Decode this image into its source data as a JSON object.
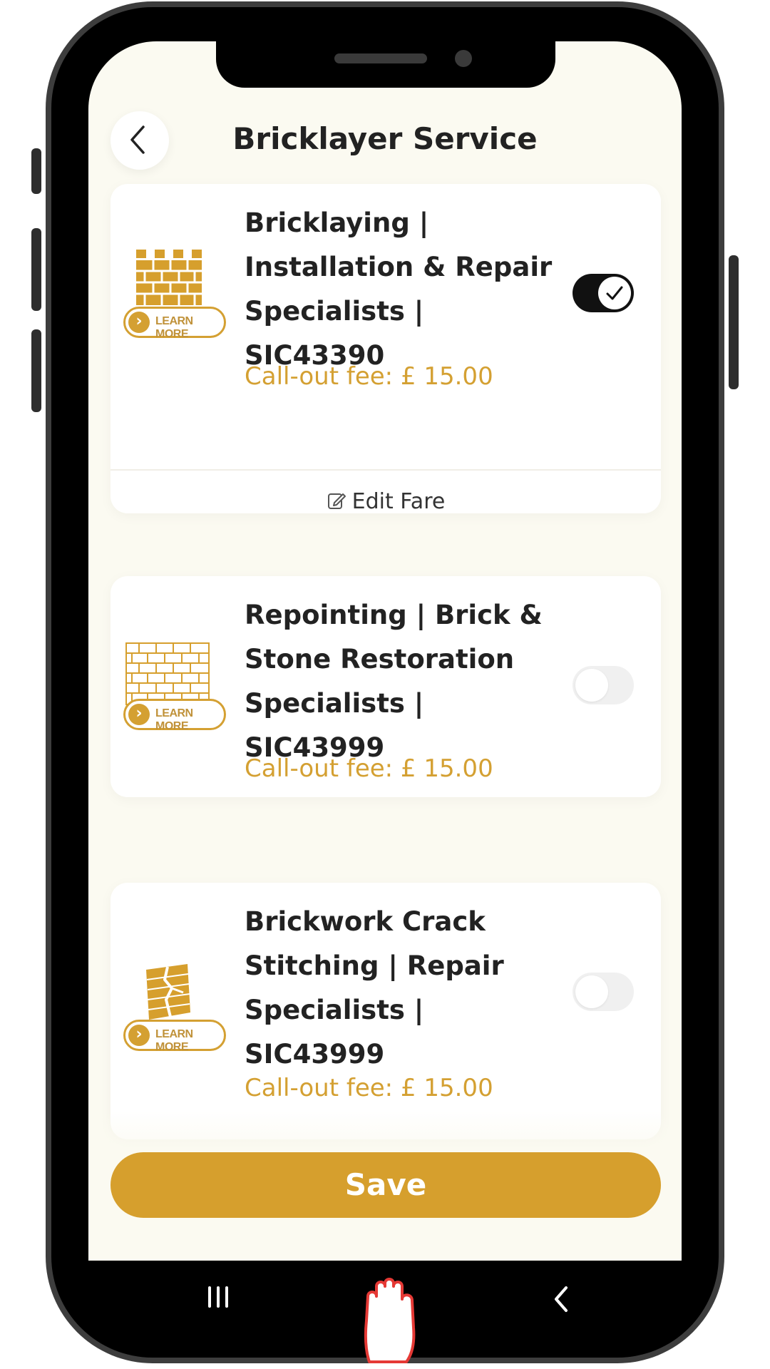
{
  "header": {
    "title": "Bricklayer Service",
    "back_icon": "chevron-left-icon"
  },
  "services": [
    {
      "title": "Bricklaying |\nInstallation & Repair\nSpecialists |\nSIC43390",
      "fee": "Call-out fee: £ 15.00",
      "learn_more": "LEARN MORE",
      "enabled": true,
      "edit_label": "Edit Fare",
      "icon": "brick-wall-icon"
    },
    {
      "title": "Repointing | Brick &\nStone Restoration\nSpecialists |\nSIC43999",
      "fee": "Call-out fee: £ 15.00",
      "learn_more": "LEARN MORE",
      "enabled": false,
      "icon": "brick-pattern-icon"
    },
    {
      "title": "Brickwork Crack\nStitching | Repair\nSpecialists |\nSIC43999",
      "fee": "Call-out fee: £ 15.00",
      "learn_more": "LEARN MORE",
      "enabled": false,
      "icon": "cracked-wall-icon"
    }
  ],
  "save_label": "Save",
  "colors": {
    "accent": "#d69f2d",
    "background": "#fbfaf1",
    "toggle_on": "#111111"
  },
  "nav": {
    "recents_icon": "recents-icon",
    "home_icon": "hand-pointer-icon",
    "back_icon": "back-arrow-icon"
  }
}
